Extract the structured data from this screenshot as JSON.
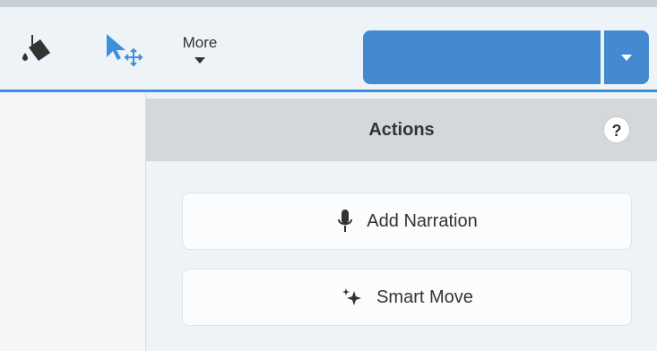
{
  "toolbar": {
    "fill_tool_icon": "paint-bucket-icon",
    "move_tool_icon": "cursor-move-icon",
    "more_label": "More",
    "preset_selector_value": "",
    "accent_color": "#458ad0"
  },
  "actions_panel": {
    "title": "Actions",
    "help_label": "?",
    "buttons": [
      {
        "label": "Add Narration",
        "icon": "microphone-icon"
      },
      {
        "label": "Smart Move",
        "icon": "sparkles-icon"
      }
    ]
  }
}
